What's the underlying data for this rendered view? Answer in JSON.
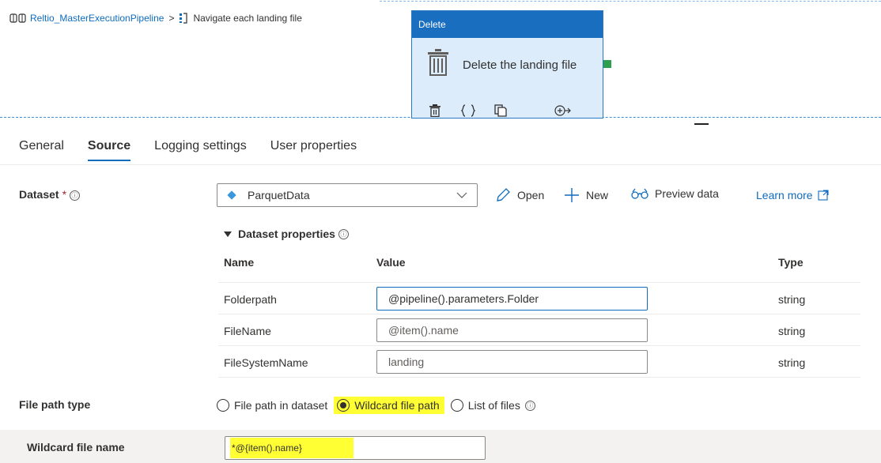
{
  "breadcrumb": {
    "pipeline": "Reltio_MasterExecutionPipeline",
    "separator": ">",
    "current": "Navigate each landing file"
  },
  "activity": {
    "type_label": "Delete",
    "title": "Delete the landing file",
    "tool_icons": [
      "trash-icon",
      "code-braces-icon",
      "copy-icon",
      "add-output-icon"
    ],
    "header_color": "#1a6ec0",
    "body_color": "#dcecfb",
    "success_port_color": "#2e9e4f"
  },
  "tabs": [
    {
      "label": "General",
      "active": false
    },
    {
      "label": "Source",
      "active": true
    },
    {
      "label": "Logging settings",
      "active": false
    },
    {
      "label": "User properties",
      "active": false
    }
  ],
  "dataset": {
    "label": "Dataset",
    "required_mark": "*",
    "info": "ⓘ",
    "value": "ParquetData",
    "open_label": "Open",
    "new_label": "New",
    "preview_label": "Preview data",
    "learn_more": "Learn more"
  },
  "dataset_properties": {
    "heading": "Dataset properties",
    "columns": {
      "name": "Name",
      "value": "Value",
      "type": "Type"
    },
    "rows": [
      {
        "name": "Folderpath",
        "value": "@pipeline().parameters.Folder",
        "type": "string"
      },
      {
        "name": "FileName",
        "value": "@item().name",
        "type": "string"
      },
      {
        "name": "FileSystemName",
        "value": "landing",
        "type": "string"
      }
    ]
  },
  "file_path_type": {
    "label": "File path type",
    "options": [
      {
        "label": "File path in dataset",
        "selected": false
      },
      {
        "label": "Wildcard file path",
        "selected": true
      },
      {
        "label": "List of files",
        "selected": false
      }
    ],
    "info": "ⓘ",
    "highlight_color": "#ffff33"
  },
  "wildcard": {
    "label": "Wildcard file name",
    "value": "*@{item().name}"
  },
  "accent_color": "#0f6cbd"
}
